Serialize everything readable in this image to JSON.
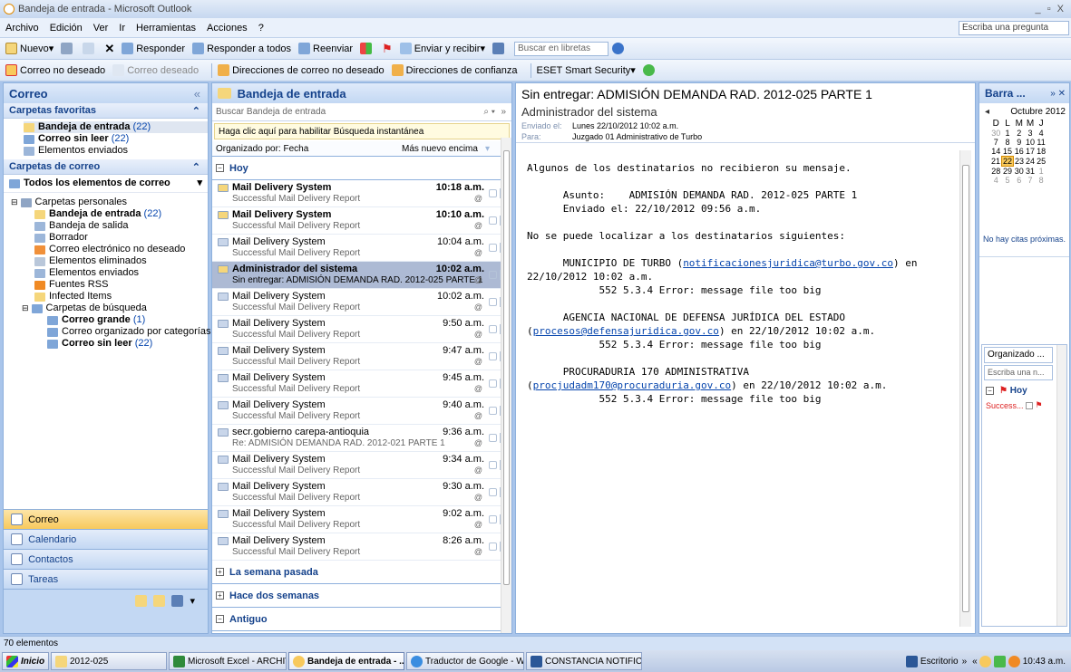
{
  "window": {
    "title": "Bandeja de entrada - Microsoft Outlook",
    "controls": "_ ▫ X"
  },
  "menu": {
    "items": [
      "Archivo",
      "Edición",
      "Ver",
      "Ir",
      "Herramientas",
      "Acciones",
      "?"
    ],
    "help_placeholder": "Escriba una pregunta"
  },
  "toolbar1": {
    "new": "Nuevo",
    "reply": "Responder",
    "reply_all": "Responder a todos",
    "forward": "Reenviar",
    "send_receive": "Enviar y recibir",
    "search_address": "Buscar en libretas"
  },
  "toolbar2": {
    "junk": "Correo no deseado",
    "not_junk": "Correo deseado",
    "blocked": "Direcciones de correo no deseado",
    "safe": "Direcciones de confianza",
    "eset": "ESET Smart Security"
  },
  "nav": {
    "header": "Correo",
    "favorites_title": "Carpetas favoritas",
    "favorites": [
      {
        "name": "Bandeja de entrada",
        "count": "(22)",
        "bold": true
      },
      {
        "name": "Correo sin leer",
        "count": "(22)",
        "bold": true
      },
      {
        "name": "Elementos enviados",
        "count": "",
        "bold": false
      }
    ],
    "mail_folders_title": "Carpetas de correo",
    "all_items": "Todos los elementos de correo",
    "personal_folders": "Carpetas personales",
    "folders": [
      {
        "name": "Bandeja de entrada",
        "count": "(22)",
        "bold": true
      },
      {
        "name": "Bandeja de salida",
        "count": "",
        "bold": false
      },
      {
        "name": "Borrador",
        "count": "",
        "bold": false
      },
      {
        "name": "Correo electrónico no deseado",
        "count": "",
        "bold": false
      },
      {
        "name": "Elementos eliminados",
        "count": "",
        "bold": false
      },
      {
        "name": "Elementos enviados",
        "count": "",
        "bold": false
      },
      {
        "name": "Fuentes RSS",
        "count": "",
        "bold": false
      },
      {
        "name": "Infected Items",
        "count": "",
        "bold": false
      }
    ],
    "search_folders": "Carpetas de búsqueda",
    "search_items": [
      {
        "name": "Correo grande",
        "count": "(1)",
        "bold": true
      },
      {
        "name": "Correo organizado por categorías",
        "count": "",
        "bold": false
      },
      {
        "name": "Correo sin leer",
        "count": "(22)",
        "bold": true
      }
    ],
    "buttons": [
      "Correo",
      "Calendario",
      "Contactos",
      "Tareas"
    ]
  },
  "list": {
    "header": "Bandeja de entrada",
    "search_placeholder": "Buscar Bandeja de entrada",
    "instant_search": "Haga clic aquí para habilitar Búsqueda instantánea",
    "arranged_by": "Organizado por: Fecha",
    "sort_order": "Más nuevo encima",
    "group_today": "Hoy",
    "messages": [
      {
        "from": "Mail Delivery System",
        "subject": "Successful Mail Delivery Report",
        "time": "10:18 a.m.",
        "unread": true,
        "selected": false
      },
      {
        "from": "Mail Delivery System",
        "subject": "Successful Mail Delivery Report",
        "time": "10:10 a.m.",
        "unread": true,
        "selected": false
      },
      {
        "from": "Mail Delivery System",
        "subject": "Successful Mail Delivery Report",
        "time": "10:04 a.m.",
        "unread": false,
        "selected": false
      },
      {
        "from": "Administrador del sistema",
        "subject": "Sin entregar: ADMISIÓN DEMANDA RAD. 2012-025 PARTE 1",
        "time": "10:02 a.m.",
        "unread": true,
        "selected": true
      },
      {
        "from": "Mail Delivery System",
        "subject": "Successful Mail Delivery Report",
        "time": "10:02 a.m.",
        "unread": false,
        "selected": false
      },
      {
        "from": "Mail Delivery System",
        "subject": "Successful Mail Delivery Report",
        "time": "9:50 a.m.",
        "unread": false,
        "selected": false
      },
      {
        "from": "Mail Delivery System",
        "subject": "Successful Mail Delivery Report",
        "time": "9:47 a.m.",
        "unread": false,
        "selected": false
      },
      {
        "from": "Mail Delivery System",
        "subject": "Successful Mail Delivery Report",
        "time": "9:45 a.m.",
        "unread": false,
        "selected": false
      },
      {
        "from": "Mail Delivery System",
        "subject": "Successful Mail Delivery Report",
        "time": "9:40 a.m.",
        "unread": false,
        "selected": false
      },
      {
        "from": "secr.gobierno carepa-antioquia",
        "subject": "Re: ADMISIÓN DEMANDA RAD. 2012-021 PARTE 1",
        "time": "9:36 a.m.",
        "unread": false,
        "selected": false
      },
      {
        "from": "Mail Delivery System",
        "subject": "Successful Mail Delivery Report",
        "time": "9:34 a.m.",
        "unread": false,
        "selected": false
      },
      {
        "from": "Mail Delivery System",
        "subject": "Successful Mail Delivery Report",
        "time": "9:30 a.m.",
        "unread": false,
        "selected": false
      },
      {
        "from": "Mail Delivery System",
        "subject": "Successful Mail Delivery Report",
        "time": "9:02 a.m.",
        "unread": false,
        "selected": false
      },
      {
        "from": "Mail Delivery System",
        "subject": "Successful Mail Delivery Report",
        "time": "8:26 a.m.",
        "unread": false,
        "selected": false
      }
    ],
    "groups": [
      "La semana pasada",
      "Hace dos semanas",
      "Antiguo"
    ]
  },
  "reading": {
    "subject": "Sin entregar: ADMISIÓN DEMANDA RAD. 2012-025 PARTE 1",
    "sender": "Administrador del sistema",
    "sent_label": "Enviado el:",
    "sent_value": "Lunes 22/10/2012 10:02 a.m.",
    "to_label": "Para:",
    "to_value": "Juzgado 01 Administrativo de Turbo",
    "body": {
      "intro": "Algunos de los destinatarios no recibieron su mensaje.",
      "asunto": "      Asunto:    ADMISIÓN DEMANDA RAD. 2012-025 PARTE 1",
      "enviado": "      Enviado el: 22/10/2012 09:56 a.m.",
      "no_localizar": "No se puede localizar a los destinatarios siguientes:",
      "r1_prefix": "      MUNICIPIO DE TURBO (",
      "r1_email": "notificacionesjuridica@turbo.gov.co",
      "r1_suffix": ") en",
      "r1_date": "22/10/2012 10:02 a.m.",
      "err1": "            552 5.3.4 Error: message file too big",
      "r2_name": "      AGENCIA NACIONAL DE DEFENSA JURÍDICA DEL ESTADO",
      "r2_email": "procesos@defensajuridica.gov.co",
      "r2_suffix": ") en 22/10/2012 10:02 a.m.",
      "err2": "            552 5.3.4 Error: message file too big",
      "r3_name": "      PROCURADURIA 170 ADMINISTRATIVA",
      "r3_email": "procjudadm170@procuraduria.gov.co",
      "r3_suffix": ") en 22/10/2012 10:02 a.m.",
      "err3": "            552 5.3.4 Error: message file too big"
    }
  },
  "todo": {
    "header": "Barra ...",
    "month": "Octubre 2012",
    "weekdays": [
      "D",
      "L",
      "M",
      "M",
      "J"
    ],
    "weeks": [
      [
        "30",
        "1",
        "2",
        "3",
        "4"
      ],
      [
        "7",
        "8",
        "9",
        "10",
        "11"
      ],
      [
        "14",
        "15",
        "16",
        "17",
        "18"
      ],
      [
        "21",
        "22",
        "23",
        "24",
        "25"
      ],
      [
        "28",
        "29",
        "30",
        "31",
        "1"
      ],
      [
        "4",
        "5",
        "6",
        "7",
        "8"
      ]
    ],
    "today": "22",
    "no_appointments": "No hay citas próximas.",
    "task_arranged": "Organizado ...",
    "task_placeholder": "Escriba una n...",
    "task_group": "Hoy",
    "task_item": "Success..."
  },
  "status": {
    "items": "70 elementos"
  },
  "taskbar": {
    "start": "Inicio",
    "items": [
      "2012-025",
      "Microsoft Excel - ARCHIV...",
      "Bandeja de entrada - ...",
      "Traductor de Google - Wi...",
      "CONSTANCIA NOTIFICA..."
    ],
    "desktop": "Escritorio",
    "clock": "10:43 a.m."
  },
  "colors": {
    "accent": "#15428b",
    "selected": "#adbad4",
    "active_nav": "#f8c95c",
    "link": "#0645ad"
  }
}
